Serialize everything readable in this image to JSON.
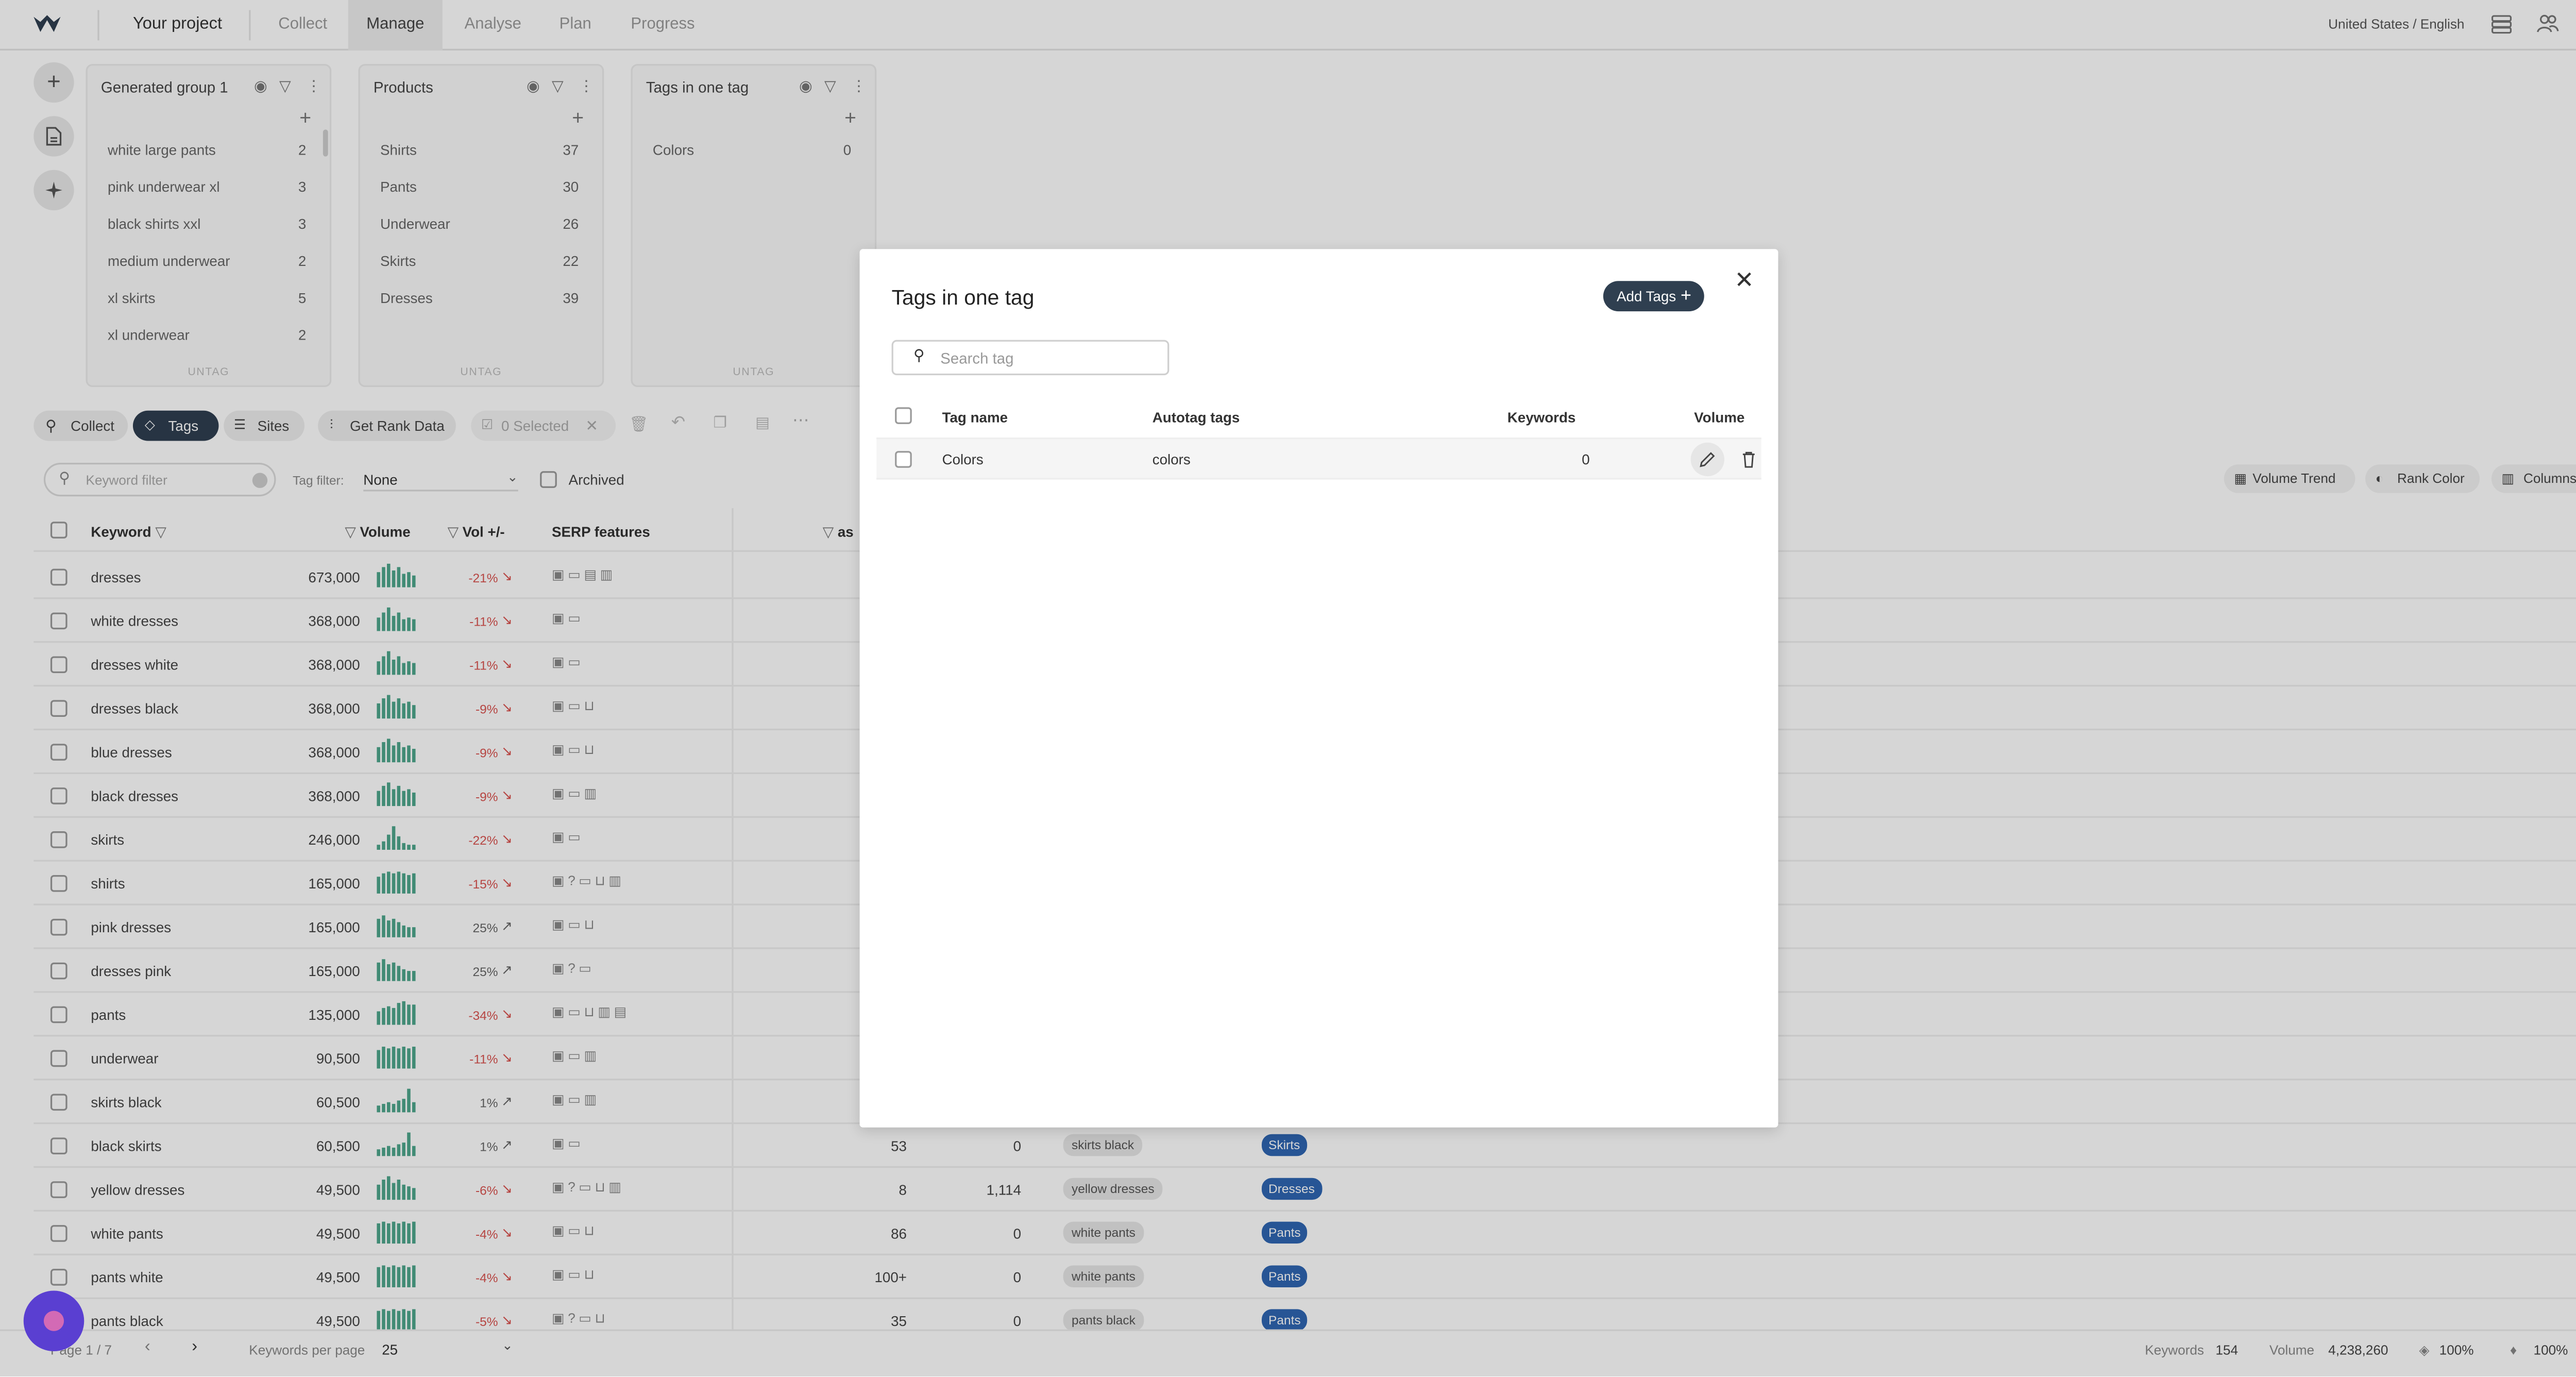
{
  "nav": {
    "project": "Your project",
    "tabs": [
      "Collect",
      "Manage",
      "Analyse",
      "Plan",
      "Progress"
    ],
    "active_tab": "Manage",
    "locale": "United States / English"
  },
  "tag_groups": [
    {
      "title": "Generated group 1",
      "rows": [
        {
          "label": "white large pants",
          "count": "2"
        },
        {
          "label": "pink underwear xl",
          "count": "3"
        },
        {
          "label": "black shirts xxl",
          "count": "3"
        },
        {
          "label": "medium underwear",
          "count": "2"
        },
        {
          "label": "xl skirts",
          "count": "5"
        },
        {
          "label": "xl underwear",
          "count": "2"
        }
      ],
      "footer": "UNTAG"
    },
    {
      "title": "Products",
      "rows": [
        {
          "label": "Shirts",
          "count": "37"
        },
        {
          "label": "Pants",
          "count": "30"
        },
        {
          "label": "Underwear",
          "count": "26"
        },
        {
          "label": "Skirts",
          "count": "22"
        },
        {
          "label": "Dresses",
          "count": "39"
        }
      ],
      "footer": "UNTAG"
    },
    {
      "title": "Tags in one tag",
      "rows": [
        {
          "label": "Colors",
          "count": "0"
        }
      ],
      "footer": "UNTAG"
    }
  ],
  "toolbar": {
    "collect": "Collect",
    "tags": "Tags",
    "sites": "Sites",
    "rank_data": "Get Rank Data",
    "selected": "0 Selected"
  },
  "filters": {
    "keyword_placeholder": "Keyword filter",
    "tag_filter_label": "Tag filter:",
    "tag_filter_value": "None",
    "archived": "Archived",
    "volume_trend": "Volume Trend",
    "rank_color": "Rank Color",
    "columns": "Columns"
  },
  "table": {
    "headers": {
      "keyword": "Keyword",
      "volume": "Volume",
      "vol_change": "Vol +/-",
      "serp": "SERP features",
      "partial": "as"
    },
    "rows": [
      {
        "keyword": "dresses",
        "volume": "673,000",
        "change": "-21%",
        "dir": "down"
      },
      {
        "keyword": "white dresses",
        "volume": "368,000",
        "change": "-11%",
        "dir": "down"
      },
      {
        "keyword": "dresses white",
        "volume": "368,000",
        "change": "-11%",
        "dir": "down"
      },
      {
        "keyword": "dresses black",
        "volume": "368,000",
        "change": "-9%",
        "dir": "down"
      },
      {
        "keyword": "blue dresses",
        "volume": "368,000",
        "change": "-9%",
        "dir": "down"
      },
      {
        "keyword": "black dresses",
        "volume": "368,000",
        "change": "-9%",
        "dir": "down"
      },
      {
        "keyword": "skirts",
        "volume": "246,000",
        "change": "-22%",
        "dir": "down"
      },
      {
        "keyword": "shirts",
        "volume": "165,000",
        "change": "-15%",
        "dir": "down"
      },
      {
        "keyword": "pink dresses",
        "volume": "165,000",
        "change": "25%",
        "dir": "up"
      },
      {
        "keyword": "dresses pink",
        "volume": "165,000",
        "change": "25%",
        "dir": "up"
      },
      {
        "keyword": "pants",
        "volume": "135,000",
        "change": "-34%",
        "dir": "down"
      },
      {
        "keyword": "underwear",
        "volume": "90,500",
        "change": "-11%",
        "dir": "down"
      },
      {
        "keyword": "skirts black",
        "volume": "60,500",
        "change": "1%",
        "dir": "up"
      },
      {
        "keyword": "black skirts",
        "volume": "60,500",
        "change": "1%",
        "dir": "up"
      },
      {
        "keyword": "yellow dresses",
        "volume": "49,500",
        "change": "-6%",
        "dir": "down"
      },
      {
        "keyword": "white pants",
        "volume": "49,500",
        "change": "-4%",
        "dir": "down"
      },
      {
        "keyword": "pants white",
        "volume": "49,500",
        "change": "-4%",
        "dir": "down"
      },
      {
        "keyword": "pants black",
        "volume": "49,500",
        "change": "-5%",
        "dir": "down"
      }
    ],
    "visible_right": [
      {
        "a": "53",
        "b": "0",
        "autotag": "skirts black",
        "tag": "Skirts"
      },
      {
        "a": "8",
        "b": "1,114",
        "autotag": "yellow dresses",
        "tag": "Dresses"
      },
      {
        "a": "86",
        "b": "0",
        "autotag": "white pants",
        "tag": "Pants"
      },
      {
        "a": "100+",
        "b": "0",
        "autotag": "white pants",
        "tag": "Pants"
      },
      {
        "a": "35",
        "b": "0",
        "autotag": "pants black",
        "tag": "Pants"
      }
    ]
  },
  "footer": {
    "page": "Page 1 / 7",
    "per_page_label": "Keywords per page",
    "per_page_value": "25",
    "keywords_label": "Keywords",
    "keywords_value": "154",
    "volume_label": "Volume",
    "volume_value": "4,238,260",
    "pct1": "100%",
    "pct2": "100%"
  },
  "modal": {
    "title": "Tags in one tag",
    "add_button": "Add Tags",
    "search_placeholder": "Search tag",
    "headers": {
      "tag_name": "Tag name",
      "autotag": "Autotag tags",
      "keywords": "Keywords",
      "volume": "Volume"
    },
    "rows": [
      {
        "tag_name": "Colors",
        "autotag": "colors",
        "keywords": "0"
      }
    ]
  },
  "colors": {
    "accent_dark": "#2f3f50",
    "negative": "#d9534f",
    "chart_green": "#4ea68c",
    "tag_blue": "#2f66b2",
    "chat_purple": "#5a3fd1"
  }
}
